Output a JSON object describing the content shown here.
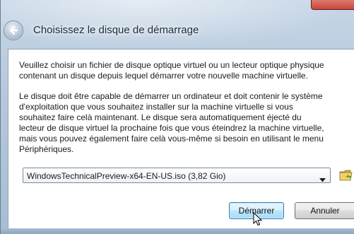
{
  "window": {
    "title": "Choisissez le disque de démarrage"
  },
  "content": {
    "paragraph1": [
      "Veuillez choisir un fichier de disque optique virtuel ou un lecteur optique physique",
      "contenant un disque depuis lequel démarrer votre nouvelle machine virtuelle."
    ],
    "paragraph2": [
      "Le disque doit être capable de démarrer un ordinateur et doit contenir le système",
      "d'exploitation que vous souhaitez installer sur la machine virtuelle si vous",
      "souhaitez faire celà maintenant. Le disque sera automatiquement éjecté du",
      "lecteur de disque virtuel la prochaine fois que vous éteindrez la machine virtuelle,",
      "mais vous pouvez également faire celà vous-même si besoin en utilisant le menu",
      "Périphériques."
    ],
    "disk_select": {
      "value": "WindowsTechnicalPreview-x64-EN-US.iso (3,82 Gio)"
    }
  },
  "buttons": {
    "start_label": "Démarrer",
    "cancel_label": "Annuler"
  },
  "icons": {
    "back": "back-arrow-icon",
    "dropdown": "chevron-down-icon",
    "folder": "folder-icon",
    "cursor": "mouse-pointer-icon"
  }
}
